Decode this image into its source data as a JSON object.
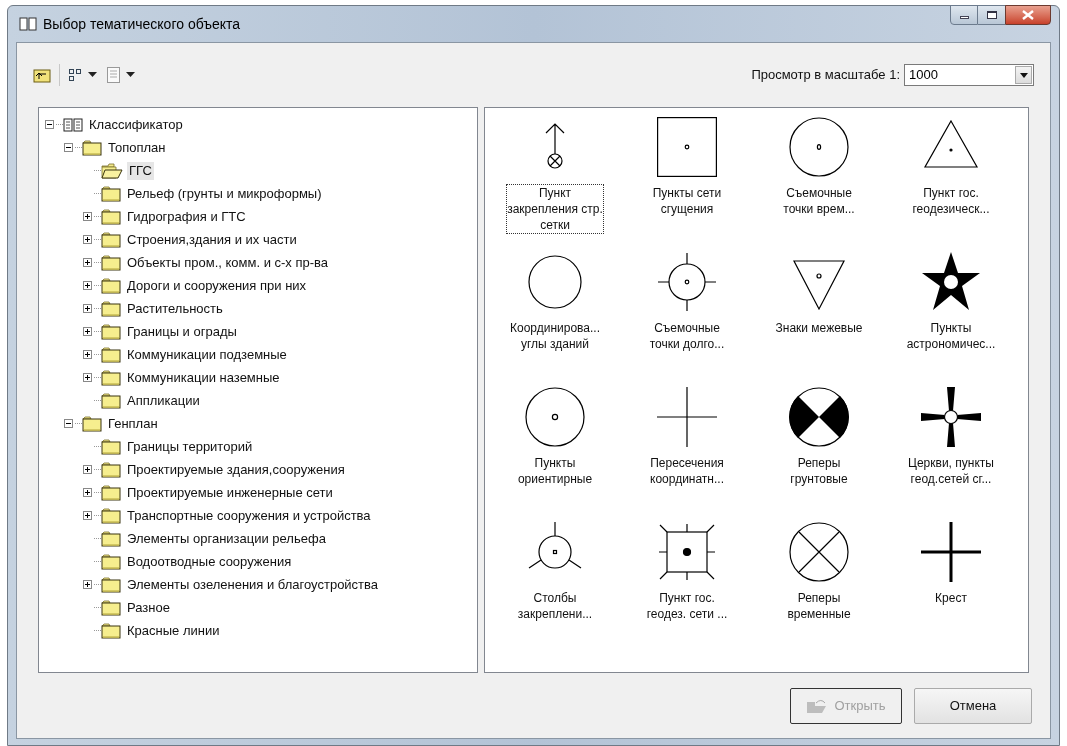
{
  "window": {
    "title": "Выбор тематического объекта"
  },
  "toolbar": {
    "scale_label": "Просмотр в масштабе 1:",
    "scale_value": "1000"
  },
  "tree": [
    {
      "label": "Классификатор",
      "kind": "book",
      "expanded": true,
      "selected": false,
      "children": [
        {
          "label": "Топоплан",
          "kind": "folder",
          "expanded": true,
          "selected": false,
          "children": [
            {
              "label": "ГГС",
              "kind": "folder",
              "selected": true
            },
            {
              "label": "Рельеф (грунты и микроформы)",
              "kind": "folder",
              "selected": false
            },
            {
              "label": "Гидрография и ГТС",
              "kind": "folder",
              "expanded": false,
              "selected": false
            },
            {
              "label": "Строения,здания и их части",
              "kind": "folder",
              "expanded": false,
              "selected": false
            },
            {
              "label": "Объекты пром., комм. и с-х пр-ва",
              "kind": "folder",
              "expanded": false,
              "selected": false
            },
            {
              "label": "Дороги и сооружения при них",
              "kind": "folder",
              "expanded": false,
              "selected": false
            },
            {
              "label": "Растительность",
              "kind": "folder",
              "expanded": false,
              "selected": false
            },
            {
              "label": "Границы и ограды",
              "kind": "folder",
              "expanded": false,
              "selected": false
            },
            {
              "label": "Коммуникации подземные",
              "kind": "folder",
              "expanded": false,
              "selected": false
            },
            {
              "label": "Коммуникации наземные",
              "kind": "folder",
              "expanded": false,
              "selected": false
            },
            {
              "label": "Аппликации",
              "kind": "folder",
              "selected": false
            }
          ]
        },
        {
          "label": "Генплан",
          "kind": "folder",
          "expanded": true,
          "selected": false,
          "children": [
            {
              "label": "Границы территорий",
              "kind": "folder",
              "selected": false
            },
            {
              "label": "Проектируемые здания,сооружения",
              "kind": "folder",
              "expanded": false,
              "selected": false
            },
            {
              "label": "Проектируемые инженерные сети",
              "kind": "folder",
              "expanded": false,
              "selected": false
            },
            {
              "label": "Транспортные сооружения и устройства",
              "kind": "folder",
              "expanded": false,
              "selected": false
            },
            {
              "label": "Элементы организации рельефа",
              "kind": "folder",
              "selected": false
            },
            {
              "label": "Водоотводные сооружения",
              "kind": "folder",
              "selected": false
            },
            {
              "label": "Элементы озеленения и благоустройства",
              "kind": "folder",
              "expanded": false,
              "selected": false
            },
            {
              "label": "Разное",
              "kind": "folder",
              "selected": false
            },
            {
              "label": "Красные линии",
              "kind": "folder",
              "selected": false
            }
          ]
        }
      ]
    }
  ],
  "symbols": [
    {
      "label": "Пункт закрепления стр. сетки",
      "kind": "arrow-circle-cross",
      "selected": true
    },
    {
      "label": "Пункты сети сгущения",
      "kind": "square-dot",
      "selected": false
    },
    {
      "label": "Съемочные точки врем...",
      "kind": "circle-dot",
      "selected": false
    },
    {
      "label": "Пункт гос. геодезическ...",
      "kind": "triangle-dot",
      "selected": false
    },
    {
      "label": "Координирова... углы зданий",
      "kind": "circle",
      "selected": false
    },
    {
      "label": "Съемочные точки долго...",
      "kind": "circle-ticks",
      "selected": false
    },
    {
      "label": "Знаки межевые",
      "kind": "triangle-down",
      "selected": false
    },
    {
      "label": "Пункты астрономичес...",
      "kind": "star",
      "selected": false
    },
    {
      "label": "Пункты ориентирные",
      "kind": "circle-small-dot",
      "selected": false
    },
    {
      "label": "Пересечения координатн...",
      "kind": "thin-cross",
      "selected": false
    },
    {
      "label": "Реперы грунтовые",
      "kind": "checker-circle",
      "selected": false
    },
    {
      "label": "Церкви, пункты геод.сетей сг...",
      "kind": "wedge-cross",
      "selected": false
    },
    {
      "label": "Столбы закреплени...",
      "kind": "circle-three-ticks",
      "selected": false
    },
    {
      "label": "Пункт гос. геодез. сети ...",
      "kind": "square-ticks",
      "selected": false
    },
    {
      "label": "Реперы временные",
      "kind": "circle-x",
      "selected": false
    },
    {
      "label": "Крест",
      "kind": "bold-cross",
      "selected": false
    }
  ],
  "buttons": [
    {
      "label": "Открыть",
      "kind": "open",
      "disabled": true
    },
    {
      "label": "Отмена",
      "kind": "cancel",
      "disabled": false
    }
  ]
}
